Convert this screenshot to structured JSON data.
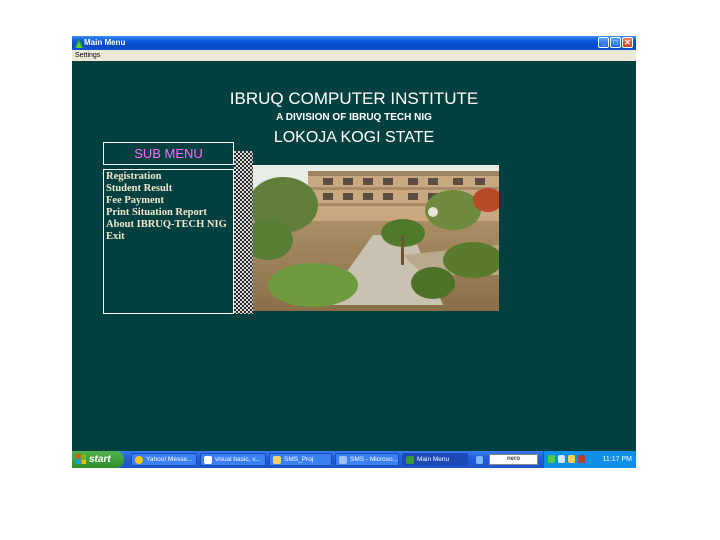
{
  "window": {
    "title": "Main Menu",
    "menu": [
      "Settings"
    ]
  },
  "heading": {
    "line1": "IBRUQ COMPUTER INSTITUTE",
    "line2": "A DIVISION OF IBRUQ TECH NIG",
    "line3": "LOKOJA KOGI STATE"
  },
  "submenu": {
    "title": "SUB MENU",
    "items": [
      "Registration",
      "Student Result",
      "Fee Payment",
      "Print Situation Report",
      "About IBRUQ-TECH NIG",
      "Exit"
    ]
  },
  "taskbar": {
    "start_label": "start",
    "buttons": [
      "Yahoo! Messe...",
      "visual basic, v...",
      "SMS_Proj",
      "SMS - Microso...",
      "Main Menu"
    ],
    "tray_badge": "nero",
    "clock": "11:17 PM"
  },
  "colors": {
    "window_bg": "#054040",
    "submenu_title": "#ff6cff",
    "submenu_text": "#f0e8cc",
    "titlebar": "#0a59dd"
  },
  "icons": [
    "app-icon",
    "minimize-icon",
    "maximize-icon",
    "close-icon",
    "windows-logo-icon",
    "building-photo"
  ]
}
